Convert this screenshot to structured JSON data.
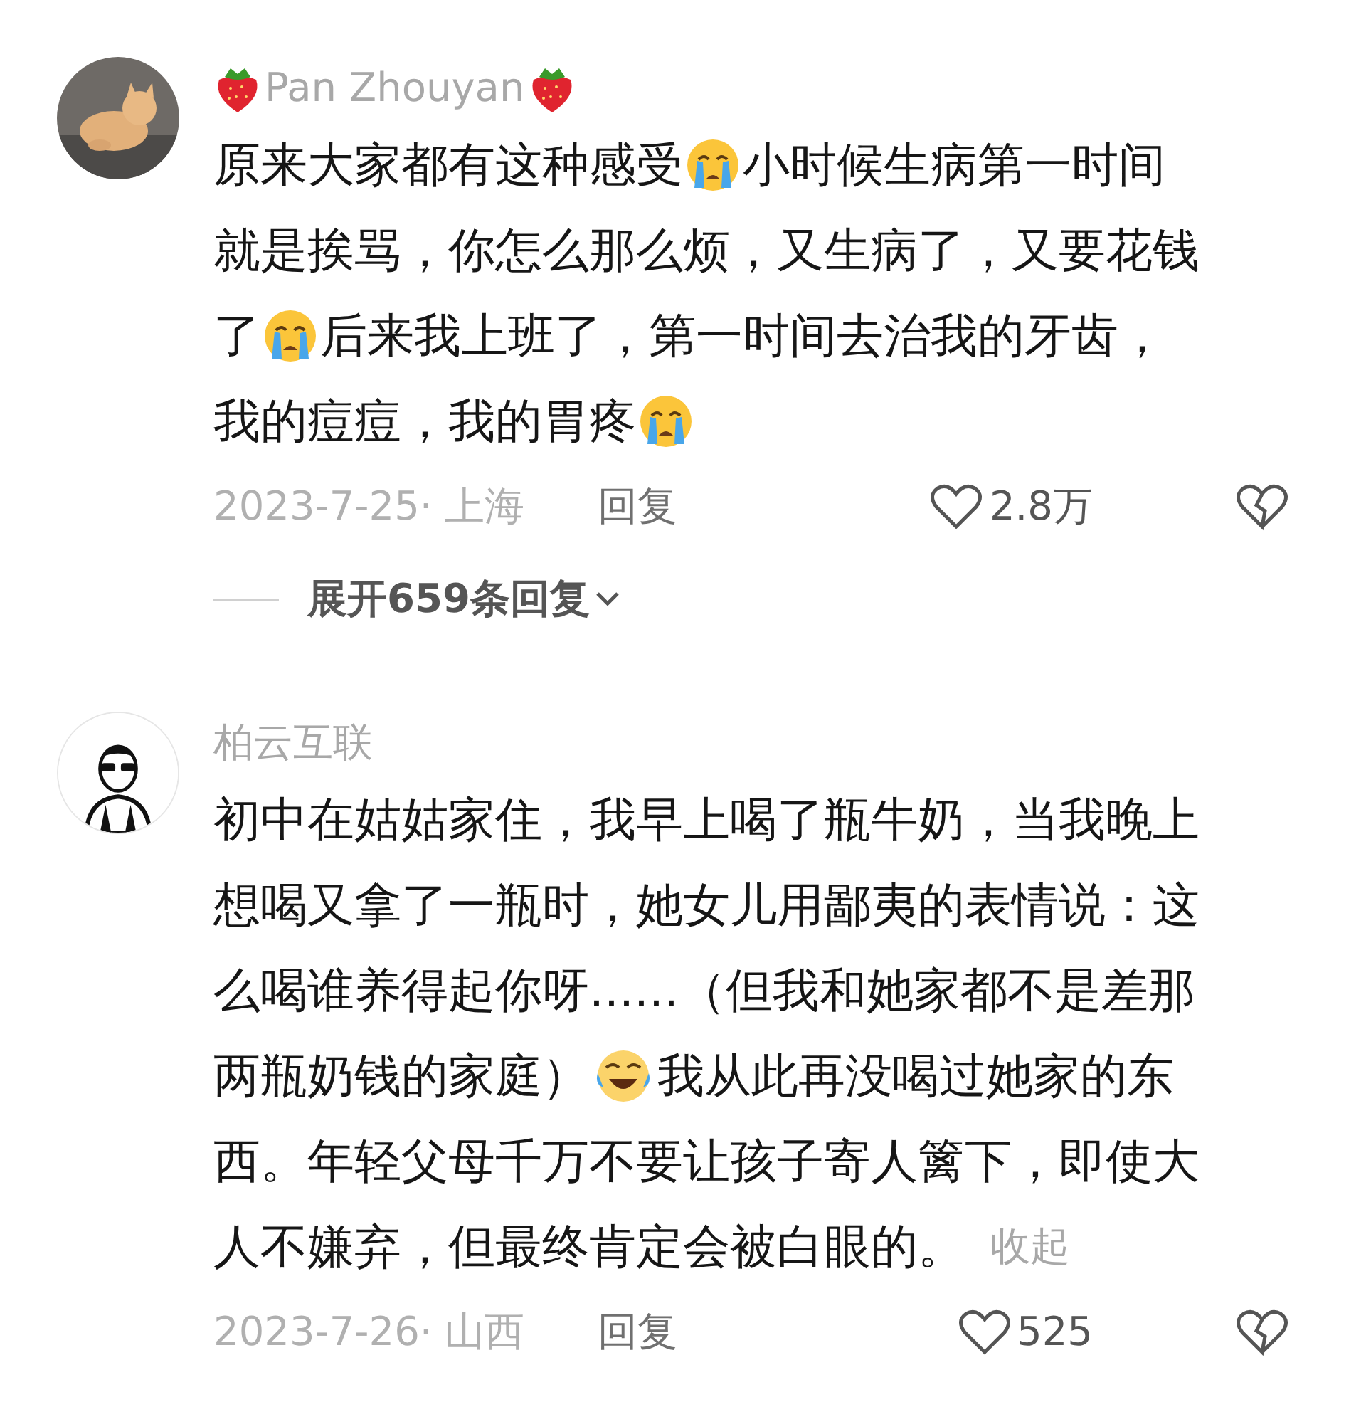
{
  "comments": [
    {
      "avatar": {
        "kind": "picture"
      },
      "author": [
        {
          "kind": "strawberry"
        },
        {
          "kind": "text",
          "text": "Pan Zhouyan"
        },
        {
          "kind": "strawberry"
        }
      ],
      "body_lines": [
        [
          {
            "kind": "text",
            "text": "原来大家都有这种感受"
          },
          {
            "kind": "crying"
          },
          {
            "kind": "text",
            "text": "小时候生病第一时间"
          }
        ],
        [
          {
            "kind": "text",
            "text": "就是挨骂，你怎么那么烦，又生病了，又要花钱"
          }
        ],
        [
          {
            "kind": "text",
            "text": "了"
          },
          {
            "kind": "crying"
          },
          {
            "kind": "text",
            "text": "后来我上班了，第一时间去治我的牙齿，"
          }
        ],
        [
          {
            "kind": "text",
            "text": "我的痘痘，我的胃疼"
          },
          {
            "kind": "crying"
          }
        ]
      ],
      "date_location": "2023-7-25· 上海",
      "reply": "回复",
      "likes": "2.8万",
      "replies_toggle": "展开659条回复"
    },
    {
      "avatar": {
        "kind": "drawing"
      },
      "author": [
        {
          "kind": "text",
          "text": "柏云互联"
        }
      ],
      "body_lines": [
        [
          {
            "kind": "text",
            "text": "初中在姑姑家住，我早上喝了瓶牛奶，当我晚上"
          }
        ],
        [
          {
            "kind": "text",
            "text": "想喝又拿了一瓶时，她女儿用鄙夷的表情说：这"
          }
        ],
        [
          {
            "kind": "text",
            "text": "么喝谁养得起你呀......（但我和她家都不是差那"
          }
        ],
        [
          {
            "kind": "text",
            "text": "两瓶奶钱的家庭）"
          },
          {
            "kind": "laughing"
          },
          {
            "kind": "text",
            "text": "我从此再没喝过她家的东"
          }
        ],
        [
          {
            "kind": "text",
            "text": "西。年轻父母千万不要让孩子寄人篱下，即使大"
          }
        ],
        [
          {
            "kind": "text",
            "text": "人不嫌弃，但最终肯定会被白眼的。"
          }
        ]
      ],
      "collapse_link": "收起",
      "date_location": "2023-7-26· 山西",
      "reply": "回复",
      "likes": "525"
    }
  ]
}
